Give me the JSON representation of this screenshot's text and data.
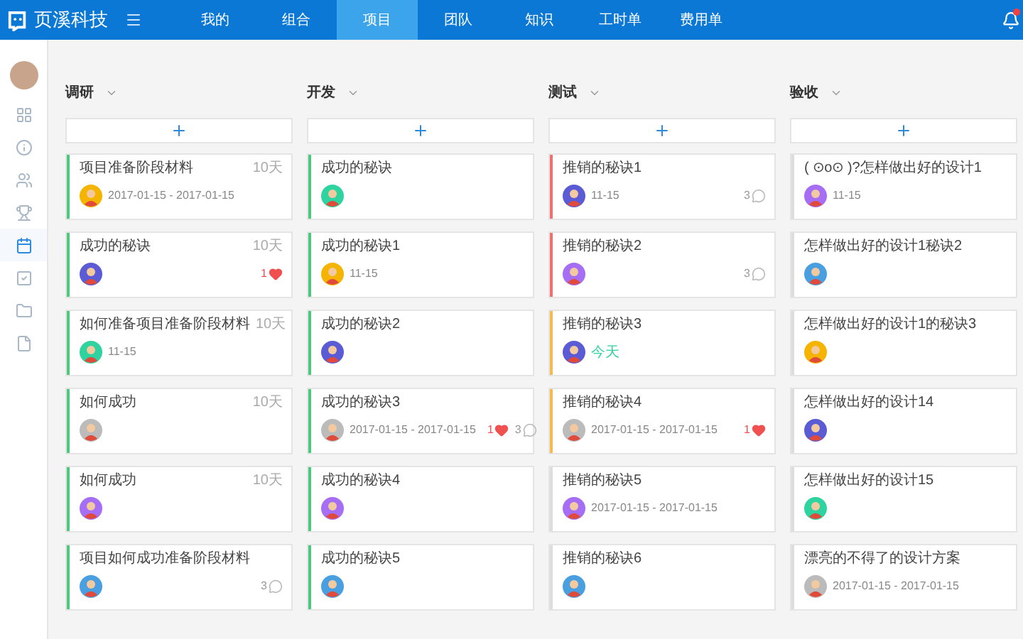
{
  "brand": {
    "name": "页溪科技"
  },
  "nav": [
    {
      "label": "我的",
      "selected": false
    },
    {
      "label": "组合",
      "selected": false
    },
    {
      "label": "项目",
      "selected": true
    },
    {
      "label": "团队",
      "selected": false
    },
    {
      "label": "知识",
      "selected": false
    },
    {
      "label": "工时单",
      "selected": false
    },
    {
      "label": "费用单",
      "selected": false
    }
  ],
  "notifications": {
    "unread": true
  },
  "sidebar": {
    "items": [
      {
        "selected": false
      },
      {
        "selected": false
      },
      {
        "selected": false
      },
      {
        "selected": false
      },
      {
        "selected": true
      },
      {
        "selected": false
      },
      {
        "selected": false
      },
      {
        "selected": false
      }
    ]
  },
  "columns": [
    {
      "title": "调研",
      "cards": [
        {
          "title": "项目准备阶段材料",
          "days": "10天",
          "color": "#4cc97f",
          "avatar": {
            "color": "#f5b400"
          },
          "date": "2017-01-15 - 2017-01-15",
          "date_today": false
        },
        {
          "title": "成功的秘诀",
          "days": "10天",
          "color": "#4cc97f",
          "avatar": {
            "color": "#5b5bd6"
          },
          "likes": "1"
        },
        {
          "title": "如何准备项目准备阶段材料",
          "days": "10天",
          "color": "#4cc97f",
          "avatar": {
            "color": "#2ed3a0"
          },
          "date": "11-15",
          "date_today": false
        },
        {
          "title": "如何成功",
          "days": "10天",
          "color": "#4cc97f",
          "avatar": {
            "color": "#bbbbbb"
          }
        },
        {
          "title": "如何成功",
          "days": "10天",
          "color": "#4cc97f",
          "avatar": {
            "color": "#a66ef5"
          }
        },
        {
          "title": "项目如何成功准备阶段材料",
          "color": "#4cc97f",
          "avatar": {
            "color": "#4a9fe0"
          },
          "comments": "3"
        }
      ]
    },
    {
      "title": "开发",
      "cards": [
        {
          "title": "成功的秘诀",
          "color": "#4cc97f",
          "avatar": {
            "color": "#2ed3a0"
          }
        },
        {
          "title": "成功的秘诀1",
          "color": "#4cc97f",
          "avatar": {
            "color": "#f5b400"
          },
          "date": "11-15",
          "date_today": false
        },
        {
          "title": "成功的秘诀2",
          "color": "#4cc97f",
          "avatar": {
            "color": "#5b5bd6"
          }
        },
        {
          "title": "成功的秘诀3",
          "color": "#4cc97f",
          "avatar": {
            "color": "#bbbbbb"
          },
          "date": "2017-01-15 - 2017-01-15",
          "date_today": false,
          "likes": "1",
          "comments": "3"
        },
        {
          "title": "成功的秘诀4",
          "color": "#4cc97f",
          "avatar": {
            "color": "#a66ef5"
          }
        },
        {
          "title": "成功的秘诀5",
          "color": "#4cc97f",
          "avatar": {
            "color": "#4a9fe0"
          }
        }
      ]
    },
    {
      "title": "测试",
      "cards": [
        {
          "title": "推销的秘诀1",
          "color": "#f07070",
          "avatar": {
            "color": "#5b5bd6"
          },
          "date": "11-15",
          "date_today": false,
          "comments": "3"
        },
        {
          "title": "推销的秘诀2",
          "color": "#f07070",
          "avatar": {
            "color": "#a66ef5"
          },
          "comments": "3"
        },
        {
          "title": "推销的秘诀3",
          "color": "#f5b94e",
          "avatar": {
            "color": "#5b5bd6"
          },
          "date": "今天",
          "date_today": true
        },
        {
          "title": "推销的秘诀4",
          "color": "#f5b94e",
          "avatar": {
            "color": "#bbbbbb"
          },
          "date": "2017-01-15 - 2017-01-15",
          "date_today": false,
          "likes": "1"
        },
        {
          "title": "推销的秘诀5",
          "color": "#dddddd",
          "avatar": {
            "color": "#a66ef5"
          },
          "date": "2017-01-15 - 2017-01-15",
          "date_today": false
        },
        {
          "title": "推销的秘诀6",
          "color": "#dddddd",
          "avatar": {
            "color": "#4a9fe0"
          }
        }
      ]
    },
    {
      "title": "验收",
      "cards": [
        {
          "title": "( ⊙o⊙ )?怎样做出好的设计1",
          "color": "#dddddd",
          "avatar": {
            "color": "#a66ef5"
          },
          "date": "11-15",
          "date_today": false
        },
        {
          "title": "怎样做出好的设计1秘诀2",
          "color": "#dddddd",
          "avatar": {
            "color": "#4a9fe0"
          }
        },
        {
          "title": "怎样做出好的设计1的秘诀3",
          "color": "#dddddd",
          "avatar": {
            "color": "#f5b400"
          }
        },
        {
          "title": "怎样做出好的设计14",
          "color": "#dddddd",
          "avatar": {
            "color": "#5b5bd6"
          }
        },
        {
          "title": "怎样做出好的设计15",
          "color": "#dddddd",
          "avatar": {
            "color": "#2ed3a0"
          }
        },
        {
          "title": "漂亮的不得了的设计方案",
          "color": "#dddddd",
          "avatar": {
            "color": "#bbbbbb"
          },
          "date": "2017-01-15 - 2017-01-15",
          "date_today": false
        }
      ]
    }
  ]
}
